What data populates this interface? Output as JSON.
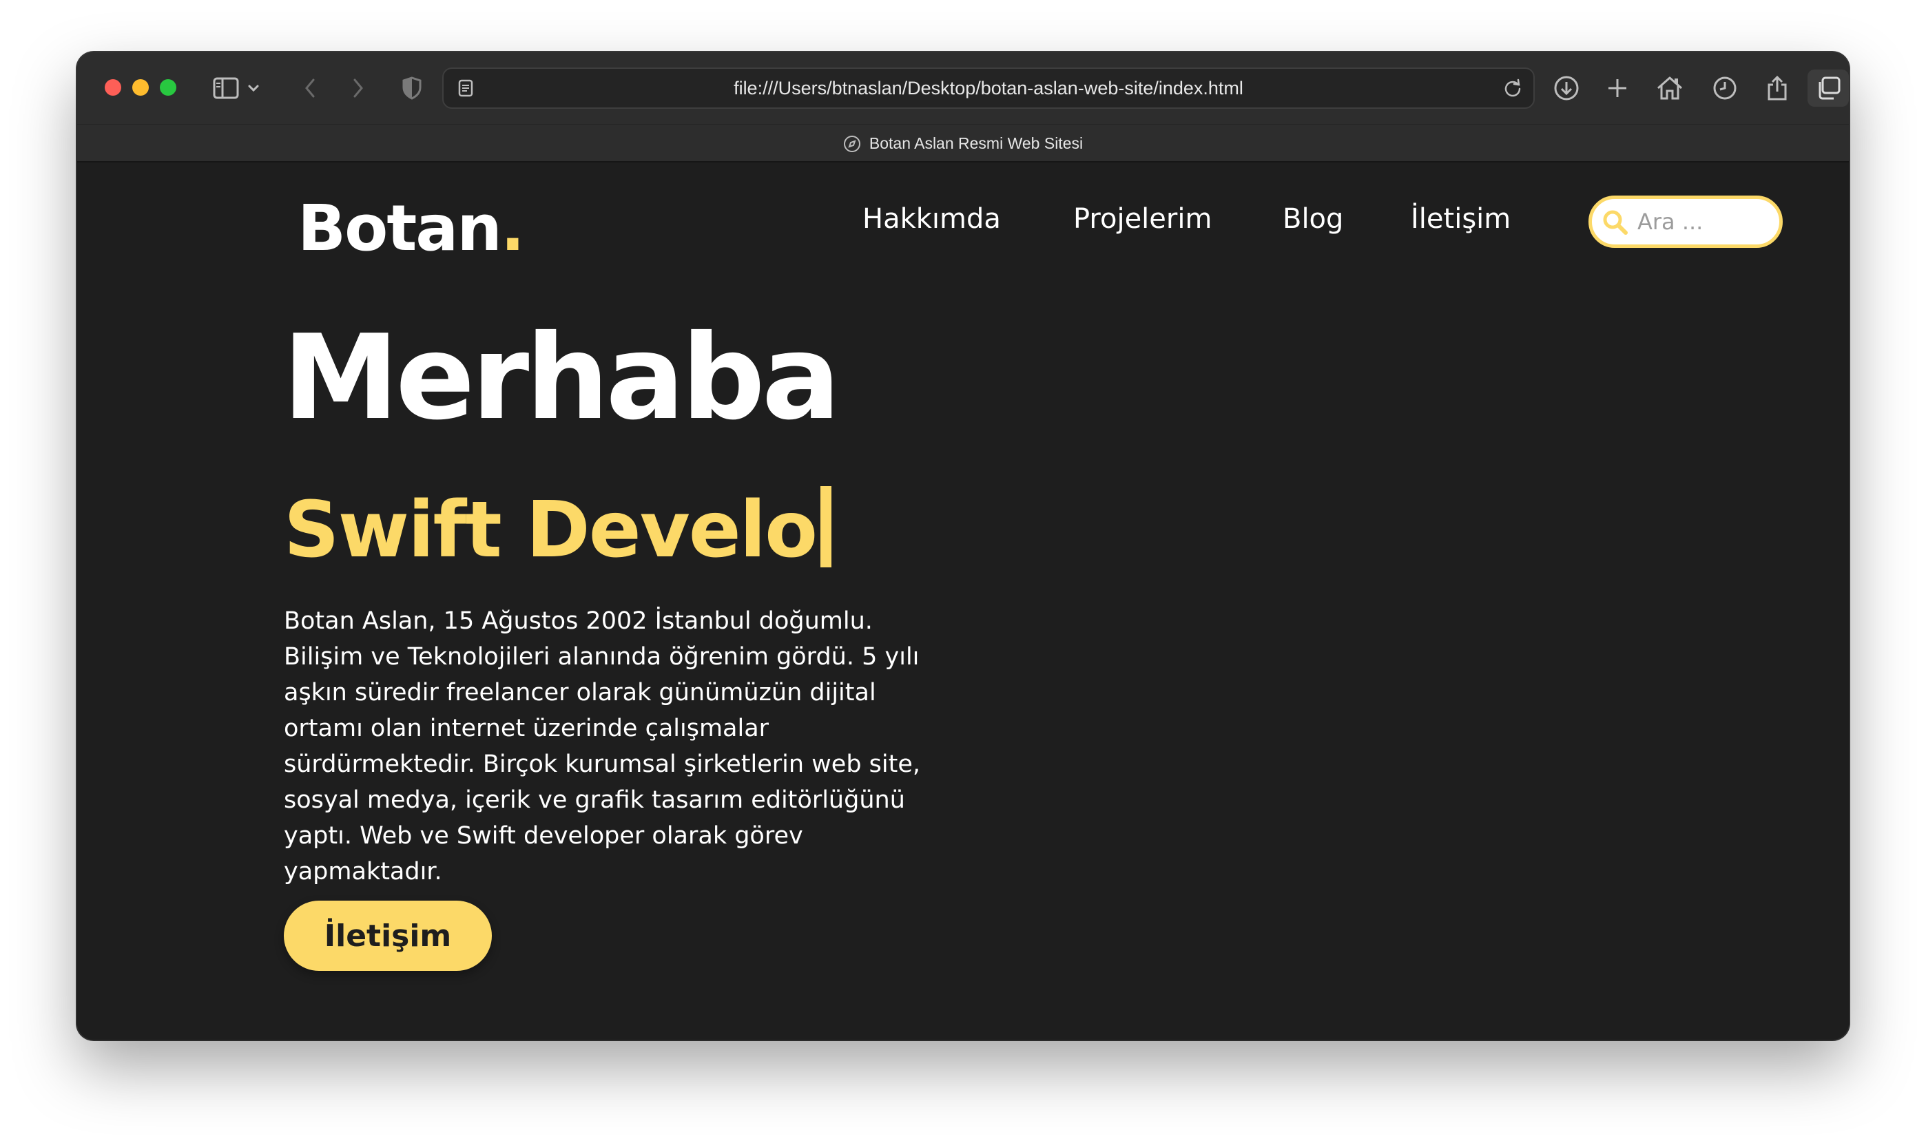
{
  "browser": {
    "url": "file:///Users/btnaslan/Desktop/botan-aslan-web-site/index.html",
    "tab_title": "Botan Aslan Resmi Web Sitesi"
  },
  "header": {
    "logo_text": "Botan",
    "logo_dot": ".",
    "nav": [
      {
        "label": "Hakkımda"
      },
      {
        "label": "Projelerim"
      },
      {
        "label": "Blog"
      },
      {
        "label": "İletişim"
      }
    ],
    "search_placeholder": "Ara ..."
  },
  "hero": {
    "title": "Merhaba",
    "subtitle": "Swift Develo",
    "description": "Botan Aslan, 15 Ağustos 2002 İstanbul doğumlu. Bilişim ve Teknolojileri alanında öğrenim gördü. 5 yılı aşkın süredir freelancer olarak günümüzün dijital ortamı olan internet üzerinde çalışmalar sürdürmektedir. Birçok kurumsal şirketlerin web site, sosyal medya, içerik ve grafik tasarım editörlüğünü yaptı. Web ve Swift developer olarak görev yapmaktadır.",
    "cta_label": "İletişim"
  },
  "colors": {
    "accent": "#fcd968",
    "background": "#1e1e1e",
    "toolbar": "#2d2d2d"
  },
  "icons": [
    "sidebar-icon",
    "chevron-down-icon",
    "back-icon",
    "forward-icon",
    "shield-icon",
    "page-icon",
    "reload-icon",
    "download-icon",
    "plus-icon",
    "home-icon",
    "history-icon",
    "share-icon",
    "tabs-icon",
    "grid-icon",
    "compass-icon",
    "search-icon"
  ]
}
